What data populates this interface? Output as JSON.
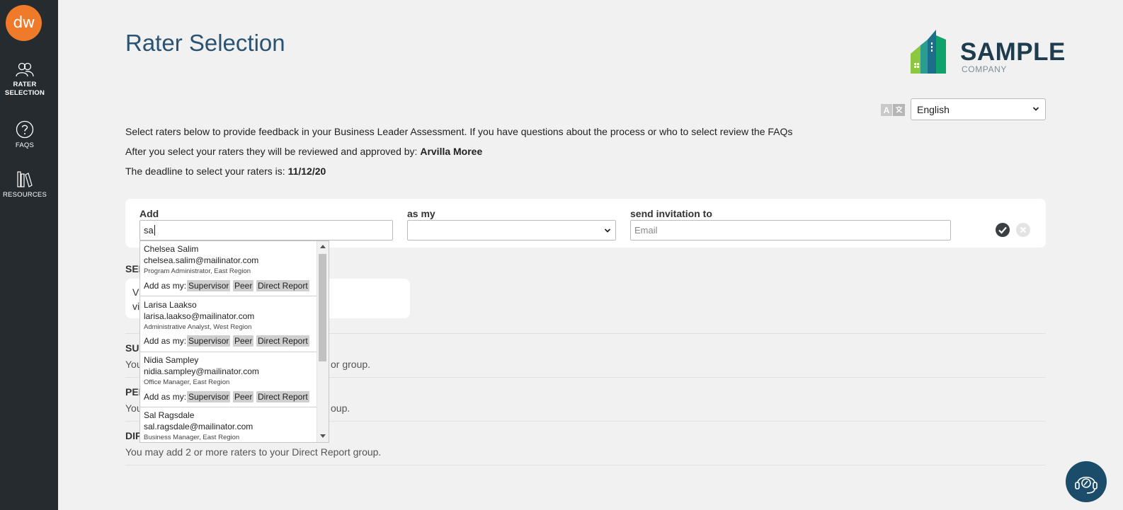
{
  "sidebar": {
    "logo_text": "dw",
    "items": [
      {
        "icon": "people-icon",
        "label_line1": "RATER",
        "label_line2": "SELECTION"
      },
      {
        "icon": "question-icon",
        "label": "FAQS"
      },
      {
        "icon": "books-icon",
        "label": "RESOURCES"
      }
    ]
  },
  "header": {
    "title": "Rater Selection",
    "brand_name": "SAMPLE",
    "brand_sub": "COMPANY"
  },
  "language": {
    "selected": "English",
    "translate_icon": "translate-icon"
  },
  "intro": {
    "line1": "Select raters below to provide feedback in your Business Leader Assessment. If you have questions about the process or who to select review the FAQs",
    "line2_prefix": "After you select your raters they will be reviewed and approved by:",
    "approver": "Arvilla Moree",
    "line3_prefix": "The deadline to select your raters is:",
    "deadline": "11/12/20"
  },
  "add_form": {
    "add_label": "Add",
    "add_value": "sa",
    "as_my_label": "as my",
    "as_my_value": "",
    "send_label": "send invitation to",
    "email_placeholder": "Email"
  },
  "suggestions": [
    {
      "name": "Chelsea Salim",
      "email": "chelsea.salim@mailinator.com",
      "title": "Program Administrator, East Region",
      "add_as": "Add as my:",
      "roles": [
        "Supervisor",
        "Peer",
        "Direct Report"
      ]
    },
    {
      "name": "Larisa Laakso",
      "email": "larisa.laakso@mailinator.com",
      "title": "Administrative Analyst, West Region",
      "add_as": "Add as my:",
      "roles": [
        "Supervisor",
        "Peer",
        "Direct Report"
      ]
    },
    {
      "name": "Nidia Sampley",
      "email": "nidia.sampley@mailinator.com",
      "title": "Office Manager, East Region",
      "add_as": "Add as my:",
      "roles": [
        "Supervisor",
        "Peer",
        "Direct Report"
      ]
    },
    {
      "name": "Sal Ragsdale",
      "email": "sal.ragsdale@mailinator.com",
      "title": "Business Manager, East Region"
    }
  ],
  "sections": {
    "selected_heading_visible": "SEL",
    "selected_line1_visible": "Vi",
    "selected_line2_visible": "vi",
    "supervisor_title_visible": "SUI",
    "supervisor_text_left": "You",
    "supervisor_text_right": "or group.",
    "peer_title_visible": "PEE",
    "peer_text_left": "You",
    "peer_text_right": "oup.",
    "direct_title_visible": "DIF",
    "direct_text": "You may add 2 or more raters to your Direct Report group."
  },
  "colors": {
    "sidebar": "#262b2f",
    "accent_orange": "#ee7a2a",
    "title_blue": "#2b5371",
    "help_button": "#1b4d6b"
  }
}
